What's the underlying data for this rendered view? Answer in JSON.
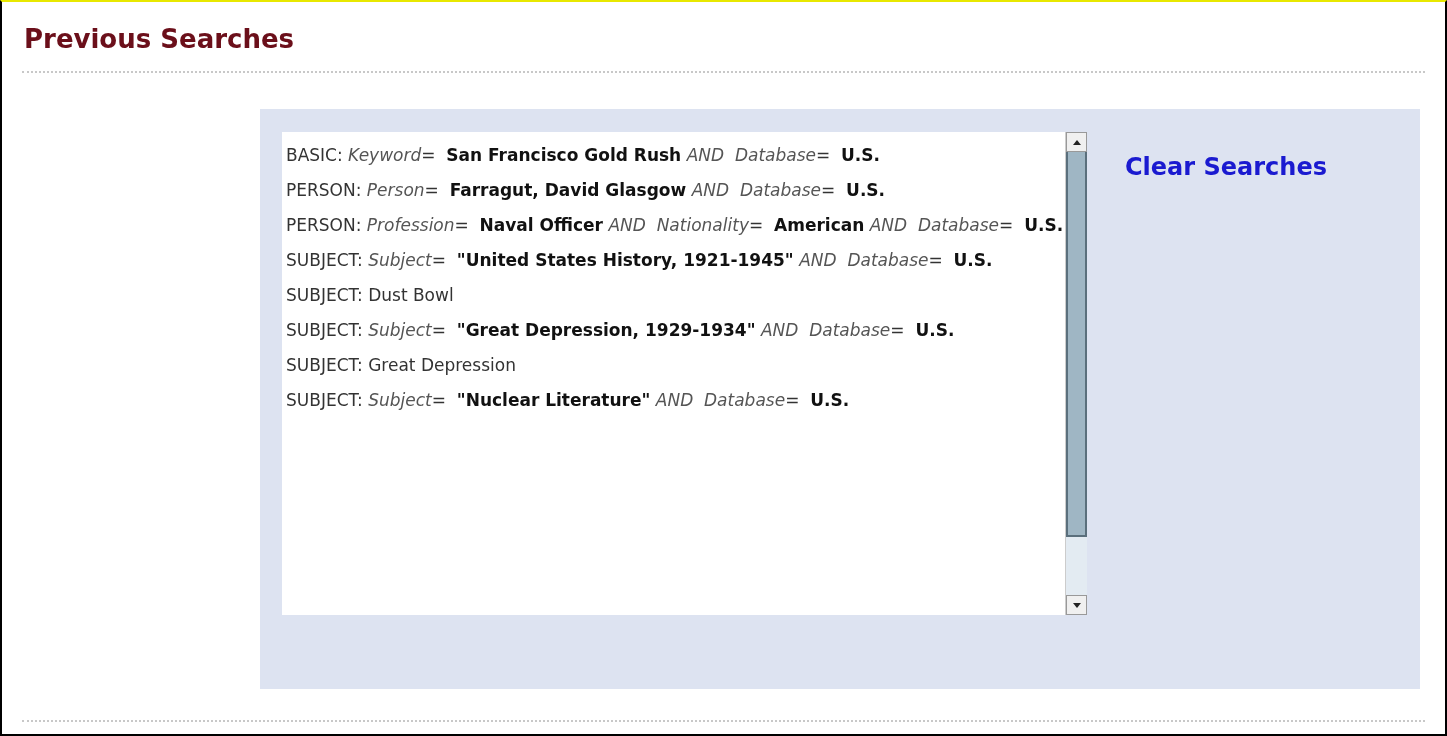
{
  "title": "Previous Searches",
  "searches": [
    "BASIC: *Keyword*=  **San Francisco Gold Rush** *AND*  *Database*=  **U.S.**",
    "PERSON: *Person*=  **Farragut, David Glasgow** *AND*  *Database*=  **U.S.**",
    "PERSON: *Profession*=  **Naval Officer** *AND*  *Nationality*=  **American** *AND*  *Database*=  **U.S.**",
    "SUBJECT: *Subject*=  **\"United States History, 1921-1945\"** *AND*  *Database*=  **U.S.**",
    "SUBJECT: Dust Bowl",
    "SUBJECT: *Subject*=  **\"Great Depression, 1929-1934\"** *AND*  *Database*=  **U.S.**",
    "SUBJECT: Great Depression",
    "SUBJECT: *Subject*=  **\"Nuclear Literature\"** *AND*  *Database*=  **U.S.**"
  ],
  "clear_link": "Clear Searches"
}
